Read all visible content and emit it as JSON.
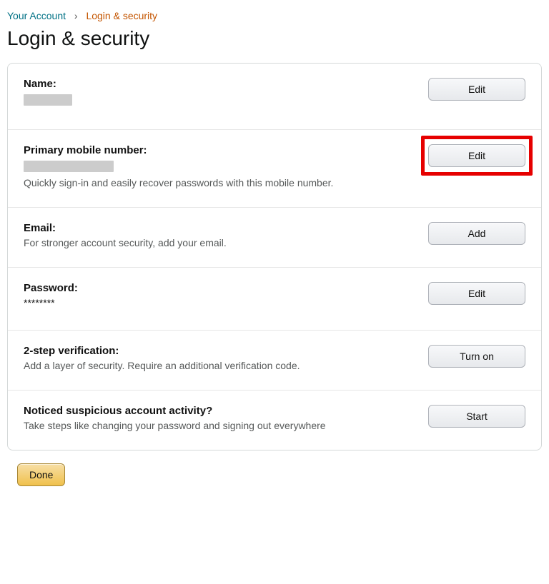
{
  "breadcrumb": {
    "parent": "Your Account",
    "separator": "›",
    "current": "Login & security"
  },
  "page_title": "Login & security",
  "rows": {
    "name": {
      "label": "Name:",
      "button": "Edit"
    },
    "mobile": {
      "label": "Primary mobile number:",
      "desc": "Quickly sign-in and easily recover passwords with this mobile number.",
      "button": "Edit"
    },
    "email": {
      "label": "Email:",
      "desc": "For stronger account security, add your email.",
      "button": "Add"
    },
    "password": {
      "label": "Password:",
      "value": "********",
      "button": "Edit"
    },
    "twostep": {
      "label": "2-step verification:",
      "desc": "Add a layer of security. Require an additional verification code.",
      "button": "Turn on"
    },
    "suspicious": {
      "label": "Noticed suspicious account activity?",
      "desc": "Take steps like changing your password and signing out everywhere",
      "button": "Start"
    }
  },
  "done_button": "Done"
}
